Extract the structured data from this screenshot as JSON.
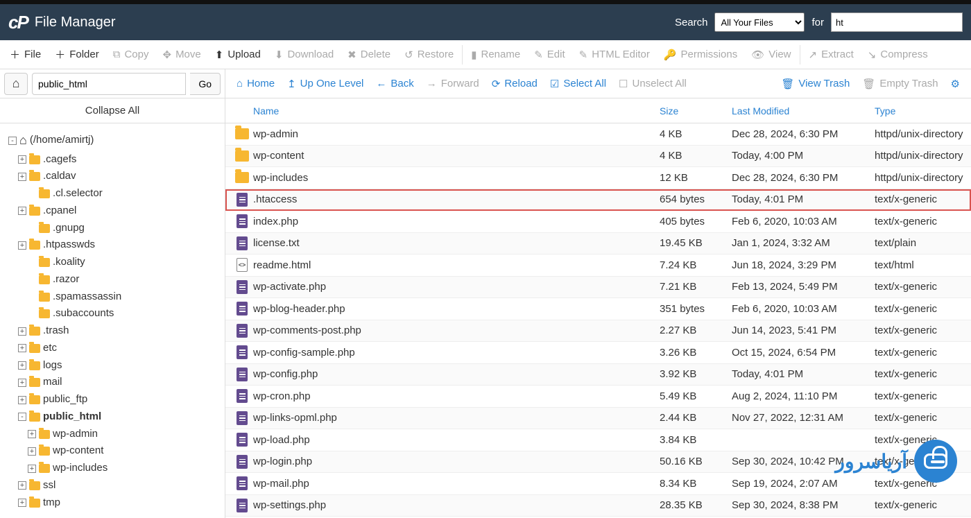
{
  "header": {
    "logo_mark": "cP",
    "title": "File Manager",
    "search_label": "Search",
    "search_scope_selected": "All Your Files",
    "for_label": "for",
    "search_value": "ht"
  },
  "toolbar": [
    {
      "id": "file",
      "label": "File",
      "icon": "plus",
      "enabled": true
    },
    {
      "id": "folder",
      "label": "Folder",
      "icon": "plus",
      "enabled": true
    },
    {
      "id": "copy",
      "label": "Copy",
      "icon": "copy",
      "enabled": false
    },
    {
      "id": "move",
      "label": "Move",
      "icon": "move",
      "enabled": false
    },
    {
      "id": "upload",
      "label": "Upload",
      "icon": "upload",
      "enabled": true
    },
    {
      "id": "download",
      "label": "Download",
      "icon": "download",
      "enabled": false
    },
    {
      "id": "delete",
      "label": "Delete",
      "icon": "delete",
      "enabled": false
    },
    {
      "id": "restore",
      "label": "Restore",
      "icon": "restore",
      "enabled": false
    },
    {
      "id": "rename",
      "label": "Rename",
      "icon": "rename",
      "enabled": false,
      "sep_before": true
    },
    {
      "id": "edit",
      "label": "Edit",
      "icon": "edit",
      "enabled": false
    },
    {
      "id": "htmleditor",
      "label": "HTML Editor",
      "icon": "htmleditor",
      "enabled": false
    },
    {
      "id": "permissions",
      "label": "Permissions",
      "icon": "permissions",
      "enabled": false
    },
    {
      "id": "view",
      "label": "View",
      "icon": "view",
      "enabled": false
    },
    {
      "id": "extract",
      "label": "Extract",
      "icon": "extract",
      "enabled": false,
      "sep_before": true
    },
    {
      "id": "compress",
      "label": "Compress",
      "icon": "compress",
      "enabled": false
    }
  ],
  "icons": {
    "plus": "＋",
    "copy": "⧉",
    "move": "✥",
    "upload": "⬆",
    "download": "⬇",
    "delete": "✖",
    "restore": "↺",
    "rename": "▮",
    "edit": "✎",
    "htmleditor": "✎",
    "permissions": "🔑",
    "view": "👁",
    "extract": "↗",
    "compress": "↘",
    "home": "⌂",
    "up": "↥",
    "back": "←",
    "forward": "→",
    "reload": "⟳",
    "check": "☑",
    "uncheck": "☐",
    "trash": "🗑",
    "gear": "⚙"
  },
  "path": {
    "value": "public_html",
    "go_label": "Go"
  },
  "nav": {
    "home": "Home",
    "up": "Up One Level",
    "back": "Back",
    "forward": "Forward",
    "reload": "Reload",
    "select_all": "Select All",
    "unselect_all": "Unselect All",
    "view_trash": "View Trash",
    "empty_trash": "Empty Trash"
  },
  "sidebar": {
    "collapse_all": "Collapse All",
    "root_label": "(/home/amirtj)",
    "tree": [
      {
        "indent": 0,
        "toggle": "-",
        "icon": "home",
        "label": "(/home/amirtj)",
        "bold": false
      },
      {
        "indent": 1,
        "toggle": "+",
        "icon": "folder",
        "label": ".cagefs"
      },
      {
        "indent": 1,
        "toggle": "+",
        "icon": "folder",
        "label": ".caldav"
      },
      {
        "indent": 2,
        "toggle": " ",
        "icon": "folder",
        "label": ".cl.selector"
      },
      {
        "indent": 1,
        "toggle": "+",
        "icon": "folder",
        "label": ".cpanel"
      },
      {
        "indent": 2,
        "toggle": " ",
        "icon": "folder",
        "label": ".gnupg"
      },
      {
        "indent": 1,
        "toggle": "+",
        "icon": "folder",
        "label": ".htpasswds"
      },
      {
        "indent": 2,
        "toggle": " ",
        "icon": "folder",
        "label": ".koality"
      },
      {
        "indent": 2,
        "toggle": " ",
        "icon": "folder",
        "label": ".razor"
      },
      {
        "indent": 2,
        "toggle": " ",
        "icon": "folder",
        "label": ".spamassassin"
      },
      {
        "indent": 2,
        "toggle": " ",
        "icon": "folder",
        "label": ".subaccounts"
      },
      {
        "indent": 1,
        "toggle": "+",
        "icon": "folder",
        "label": ".trash"
      },
      {
        "indent": 1,
        "toggle": "+",
        "icon": "folder",
        "label": "etc"
      },
      {
        "indent": 1,
        "toggle": "+",
        "icon": "folder",
        "label": "logs"
      },
      {
        "indent": 1,
        "toggle": "+",
        "icon": "folder",
        "label": "mail"
      },
      {
        "indent": 1,
        "toggle": "+",
        "icon": "folder",
        "label": "public_ftp"
      },
      {
        "indent": 1,
        "toggle": "-",
        "icon": "folder-open",
        "label": "public_html",
        "bold": true
      },
      {
        "indent": 2,
        "toggle": "+",
        "icon": "folder",
        "label": "wp-admin"
      },
      {
        "indent": 2,
        "toggle": "+",
        "icon": "folder",
        "label": "wp-content"
      },
      {
        "indent": 2,
        "toggle": "+",
        "icon": "folder",
        "label": "wp-includes"
      },
      {
        "indent": 1,
        "toggle": "+",
        "icon": "folder",
        "label": "ssl"
      },
      {
        "indent": 1,
        "toggle": "+",
        "icon": "folder",
        "label": "tmp"
      }
    ]
  },
  "columns": {
    "name": "Name",
    "size": "Size",
    "modified": "Last Modified",
    "type": "Type"
  },
  "files": [
    {
      "icon": "folder",
      "name": "wp-admin",
      "size": "4 KB",
      "modified": "Dec 28, 2024, 6:30 PM",
      "type": "httpd/unix-directory"
    },
    {
      "icon": "folder",
      "name": "wp-content",
      "size": "4 KB",
      "modified": "Today, 4:00 PM",
      "type": "httpd/unix-directory"
    },
    {
      "icon": "folder",
      "name": "wp-includes",
      "size": "12 KB",
      "modified": "Dec 28, 2024, 6:30 PM",
      "type": "httpd/unix-directory"
    },
    {
      "icon": "doc",
      "name": ".htaccess",
      "size": "654 bytes",
      "modified": "Today, 4:01 PM",
      "type": "text/x-generic",
      "highlight": true
    },
    {
      "icon": "doc",
      "name": "index.php",
      "size": "405 bytes",
      "modified": "Feb 6, 2020, 10:03 AM",
      "type": "text/x-generic"
    },
    {
      "icon": "doc",
      "name": "license.txt",
      "size": "19.45 KB",
      "modified": "Jan 1, 2024, 3:32 AM",
      "type": "text/plain"
    },
    {
      "icon": "html",
      "name": "readme.html",
      "size": "7.24 KB",
      "modified": "Jun 18, 2024, 3:29 PM",
      "type": "text/html"
    },
    {
      "icon": "doc",
      "name": "wp-activate.php",
      "size": "7.21 KB",
      "modified": "Feb 13, 2024, 5:49 PM",
      "type": "text/x-generic"
    },
    {
      "icon": "doc",
      "name": "wp-blog-header.php",
      "size": "351 bytes",
      "modified": "Feb 6, 2020, 10:03 AM",
      "type": "text/x-generic"
    },
    {
      "icon": "doc",
      "name": "wp-comments-post.php",
      "size": "2.27 KB",
      "modified": "Jun 14, 2023, 5:41 PM",
      "type": "text/x-generic"
    },
    {
      "icon": "doc",
      "name": "wp-config-sample.php",
      "size": "3.26 KB",
      "modified": "Oct 15, 2024, 6:54 PM",
      "type": "text/x-generic"
    },
    {
      "icon": "doc",
      "name": "wp-config.php",
      "size": "3.92 KB",
      "modified": "Today, 4:01 PM",
      "type": "text/x-generic"
    },
    {
      "icon": "doc",
      "name": "wp-cron.php",
      "size": "5.49 KB",
      "modified": "Aug 2, 2024, 11:10 PM",
      "type": "text/x-generic"
    },
    {
      "icon": "doc",
      "name": "wp-links-opml.php",
      "size": "2.44 KB",
      "modified": "Nov 27, 2022, 12:31 AM",
      "type": "text/x-generic"
    },
    {
      "icon": "doc",
      "name": "wp-load.php",
      "size": "3.84 KB",
      "modified": "",
      "type": "text/x-generic"
    },
    {
      "icon": "doc",
      "name": "wp-login.php",
      "size": "50.16 KB",
      "modified": "Sep 30, 2024, 10:42 PM",
      "type": "text/x-generic"
    },
    {
      "icon": "doc",
      "name": "wp-mail.php",
      "size": "8.34 KB",
      "modified": "Sep 19, 2024, 2:07 AM",
      "type": "text/x-generic"
    },
    {
      "icon": "doc",
      "name": "wp-settings.php",
      "size": "28.35 KB",
      "modified": "Sep 30, 2024, 8:38 PM",
      "type": "text/x-generic"
    }
  ],
  "watermark_text": "آریاسرور"
}
